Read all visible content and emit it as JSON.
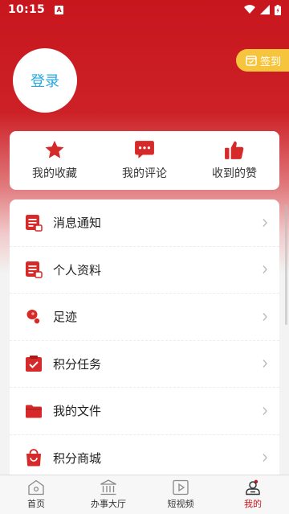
{
  "status_bar": {
    "time": "10:15",
    "notif_letter": "A"
  },
  "colors": {
    "brand_red": "#c8161d",
    "checkin_yellow": "#f6c53d",
    "login_blue": "#29a8e0"
  },
  "profile": {
    "login_label": "登录",
    "checkin_label": "签到"
  },
  "stats": [
    {
      "label": "我的收藏",
      "icon": "star-icon"
    },
    {
      "label": "我的评论",
      "icon": "comment-icon"
    },
    {
      "label": "收到的赞",
      "icon": "thumbs-up-icon"
    }
  ],
  "menu": [
    {
      "label": "消息通知",
      "icon": "message-doc-icon"
    },
    {
      "label": "个人资料",
      "icon": "profile-doc-icon"
    },
    {
      "label": "足迹",
      "icon": "footprint-icon"
    },
    {
      "label": "积分任务",
      "icon": "clipboard-check-icon"
    },
    {
      "label": "我的文件",
      "icon": "folder-icon"
    },
    {
      "label": "积分商城",
      "icon": "shopping-bag-icon"
    }
  ],
  "bottom_nav": [
    {
      "label": "首页",
      "icon": "home-icon"
    },
    {
      "label": "办事大厅",
      "icon": "hall-icon"
    },
    {
      "label": "短视频",
      "icon": "video-icon"
    },
    {
      "label": "我的",
      "icon": "user-icon",
      "active": true
    }
  ]
}
